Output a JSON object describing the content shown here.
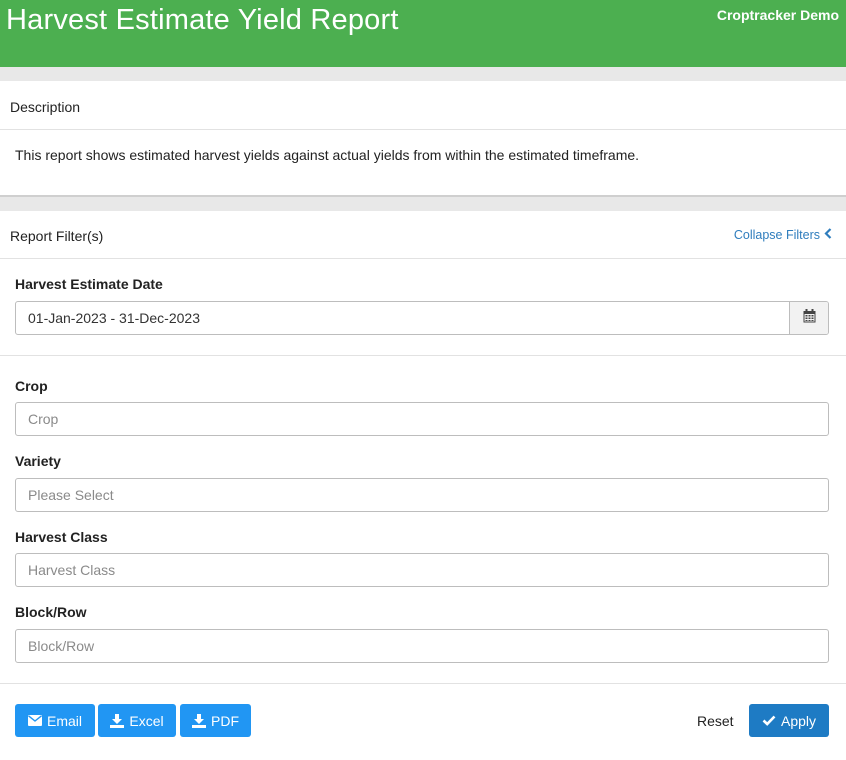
{
  "header": {
    "title": "Harvest Estimate Yield Report",
    "brand": "Croptracker Demo"
  },
  "description": {
    "heading": "Description",
    "text": "This report shows estimated harvest yields against actual yields from within the estimated timeframe."
  },
  "filters": {
    "heading": "Report Filter(s)",
    "collapse_label": "Collapse Filters",
    "harvest_date": {
      "label": "Harvest Estimate Date",
      "value": "01-Jan-2023 - 31-Dec-2023",
      "icon": "calendar-icon"
    },
    "crop": {
      "label": "Crop",
      "placeholder": "Crop"
    },
    "variety": {
      "label": "Variety",
      "placeholder": "Please Select"
    },
    "harvest_class": {
      "label": "Harvest Class",
      "placeholder": "Harvest Class"
    },
    "block_row": {
      "label": "Block/Row",
      "placeholder": "Block/Row"
    }
  },
  "actions": {
    "email": {
      "label": "Email",
      "icon": "envelope-icon"
    },
    "excel": {
      "label": "Excel",
      "icon": "download-icon"
    },
    "pdf": {
      "label": "PDF",
      "icon": "download-icon"
    },
    "reset": "Reset",
    "apply": {
      "label": "Apply",
      "icon": "check-icon"
    }
  },
  "colors": {
    "header_bg": "#4caf50",
    "button_blue": "#2196f3",
    "apply_blue": "#1e7bc4",
    "link_blue": "#2f7dbd"
  }
}
